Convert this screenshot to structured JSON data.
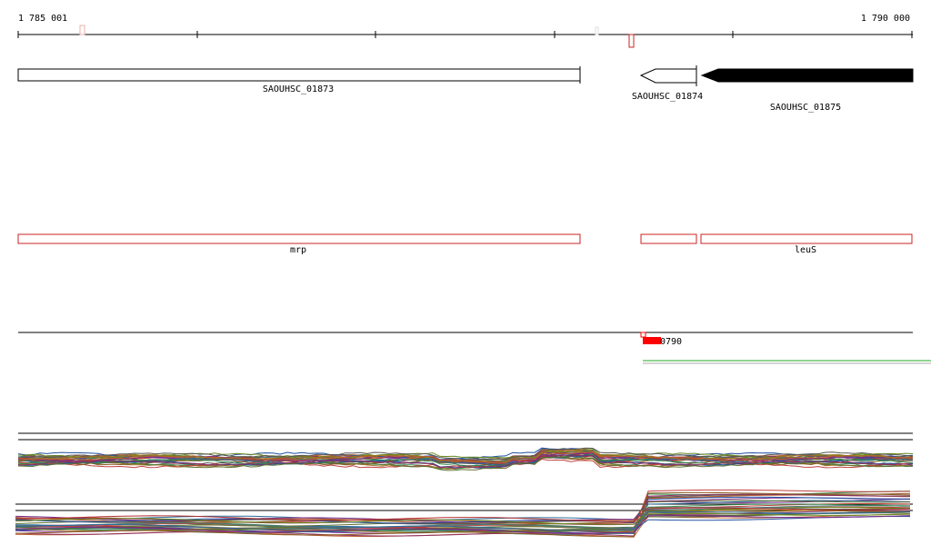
{
  "ruler": {
    "start_label": "1 785 001",
    "end_label": "1 790 000",
    "start": 1785001,
    "end": 1790000
  },
  "genes": [
    {
      "label": "SAOUHSC_01873",
      "start": 1785001,
      "end": 1788150,
      "strand": "none",
      "style": "open"
    },
    {
      "label": "SAOUHSC_01874",
      "start": 1788500,
      "end": 1788810,
      "strand": "-",
      "style": "open"
    },
    {
      "label": "SAOUHSC_01875",
      "start": 1788840,
      "end": 1790000,
      "strand": "-",
      "style": "filled"
    }
  ],
  "operons": [
    {
      "label": "mrp",
      "start": 1785001,
      "end": 1788150
    },
    {
      "label": "",
      "start": 1788500,
      "end": 1788810
    },
    {
      "label": "leuS",
      "start": 1788840,
      "end": 1790000
    }
  ],
  "feature": {
    "label": "0790",
    "start": 1788500,
    "end": 1788610
  },
  "colors": {
    "gene_outline": "#000000",
    "gene_fill": "#000000",
    "operon_outline": "#cc2222",
    "feature_fill": "#ff0000",
    "track_green": "#22aa22"
  }
}
